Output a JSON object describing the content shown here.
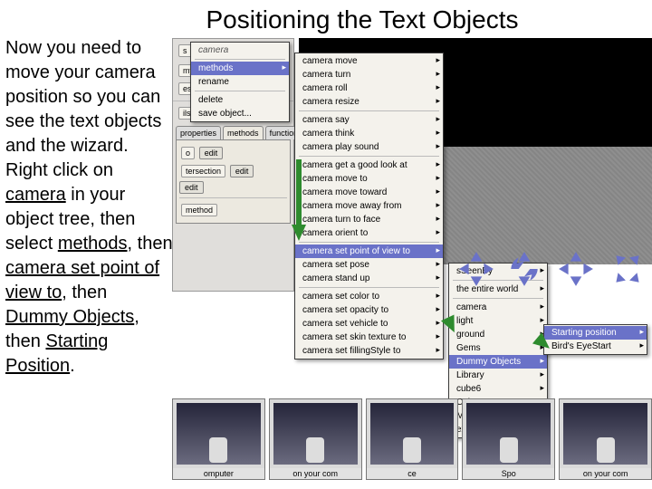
{
  "title": "Positioning the Text Objects",
  "instruction": {
    "line1": "Now you need to move your camera position so you can see the text objects and the wizard. Right click on ",
    "kw_camera": "camera",
    "mid1": " in your object tree, then select ",
    "kw_methods": "methods",
    "mid2": ", then ",
    "kw_setpov": "camera set point of view to",
    "mid3": ", then ",
    "kw_dummy": "Dummy Objects",
    "mid4": ", then ",
    "kw_start": "Starting Position",
    "period": "."
  },
  "panel": {
    "tab_props": "properties",
    "tab_methods": "methods",
    "tab_functions": "functions",
    "label_intersection": "tersection",
    "label_method": "method",
    "btn_edit": "edit",
    "label_objects": "my Objects",
    "label_less": "ess",
    "label_ils": "ils",
    "label_s": "s"
  },
  "ctx": {
    "camera": "camera",
    "methods": "methods",
    "rename": "rename",
    "delete": "delete",
    "save": "save object..."
  },
  "methods": [
    "camera move",
    "camera turn",
    "camera roll",
    "camera resize",
    "-",
    "camera say",
    "camera think",
    "camera play sound",
    "-",
    "camera get a good look at",
    "camera move to",
    "camera move toward",
    "camera move away from",
    "camera turn to face",
    "camera orient to",
    "-",
    "camera set point of view to",
    "camera set pose",
    "camera stand up",
    "-",
    "camera set color to",
    "camera set opacity to",
    "camera set vehicle to",
    "camera set skin texture to",
    "camera set fillingStyle to"
  ],
  "methods_highlight": "camera set point of view to",
  "targets": {
    "items": [
      "sSeenBy",
      "-",
      "the entire world",
      "-",
      "camera",
      "light",
      "ground",
      "Gems",
      "Dummy Objects",
      "Library",
      "cube6",
      "Cubess",
      "Mana",
      "expressions"
    ],
    "highlight": "Dummy Objects"
  },
  "dummy": {
    "items": [
      "Starting position",
      "Bird's EyeStart"
    ],
    "highlight": "Starting position"
  },
  "thumbs": {
    "cap1": "omputer",
    "cap2": "on your com",
    "cap3": "ce",
    "cap4": "Spo",
    "cap5": "on your com"
  }
}
